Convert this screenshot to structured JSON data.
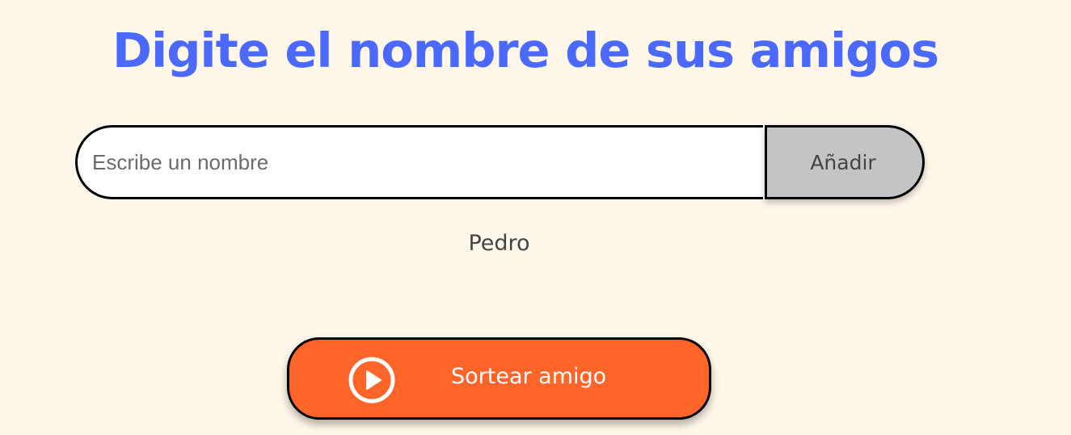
{
  "header": {
    "title": "Digite el nombre de sus amigos"
  },
  "input_section": {
    "name_input": {
      "placeholder": "Escribe un nombre",
      "value": ""
    },
    "add_button_label": "Añadir"
  },
  "friends": [
    "Pedro"
  ],
  "draw_button": {
    "label": "Sortear amigo",
    "icon": "play-circle-icon"
  },
  "colors": {
    "background": "#FFF7E9",
    "title": "#4B69FD",
    "add_button": "#C4C4C4",
    "draw_button": "#FF6528"
  }
}
